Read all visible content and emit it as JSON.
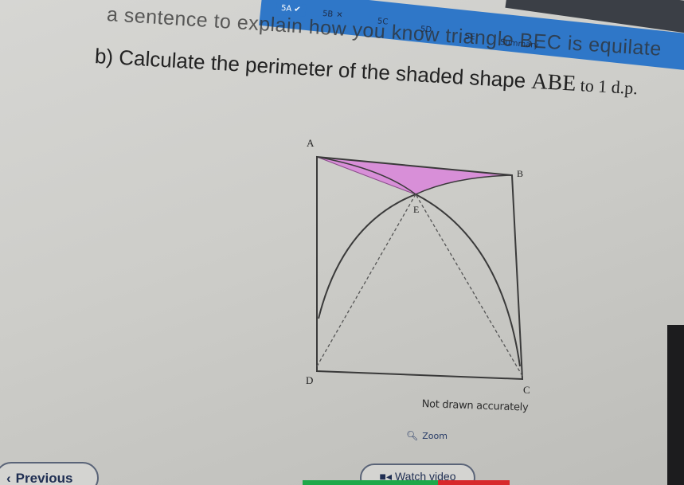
{
  "tabs": [
    {
      "label": "5A",
      "state": "done"
    },
    {
      "label": "5B",
      "state": "incorrect"
    },
    {
      "label": "5C"
    },
    {
      "label": "5D"
    },
    {
      "label": "5E"
    },
    {
      "label": "Summary"
    }
  ],
  "instruction_partial": "a sentence to explain how you know triangle BEC is equilate",
  "question": {
    "prefix": "b) Calculate the perimeter of the shaded shape ",
    "shape": "ABE",
    "suffix": " to 1 d.p."
  },
  "figure": {
    "labels": {
      "a": "A",
      "b": "B",
      "c": "C",
      "d": "D",
      "e": "E"
    },
    "shaded_color": "#d88fd8",
    "note": "Not drawn accurately"
  },
  "controls": {
    "zoom_label": "Zoom",
    "previous_label": "Previous",
    "watch_video_label": "Watch video"
  },
  "colors": {
    "accent_blue": "#2f77c8",
    "progress_green": "#1fa84a",
    "progress_red": "#d8282b"
  }
}
